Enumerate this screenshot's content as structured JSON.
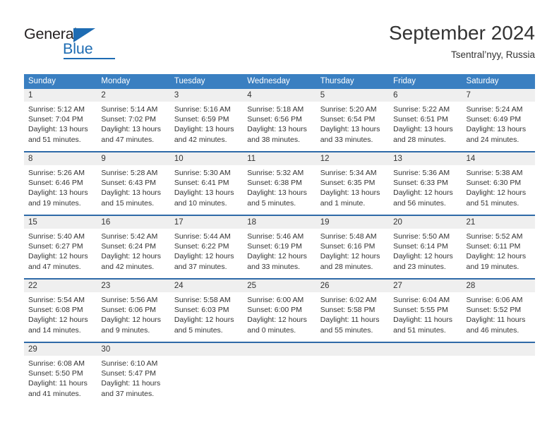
{
  "brand": {
    "name_top": "General",
    "name_bottom": "Blue",
    "accent_color": "#1e6cb3"
  },
  "header": {
    "title": "September 2024",
    "subtitle": "Tsentral’nyy, Russia"
  },
  "calendar": {
    "header_bg": "#3a7fc1",
    "row_divider_color": "#2f6aa8",
    "daynum_bg": "#efefef",
    "weekdays": [
      "Sunday",
      "Monday",
      "Tuesday",
      "Wednesday",
      "Thursday",
      "Friday",
      "Saturday"
    ],
    "weeks": [
      [
        {
          "day": "1",
          "sunrise": "Sunrise: 5:12 AM",
          "sunset": "Sunset: 7:04 PM",
          "daylight1": "Daylight: 13 hours",
          "daylight2": "and 51 minutes."
        },
        {
          "day": "2",
          "sunrise": "Sunrise: 5:14 AM",
          "sunset": "Sunset: 7:02 PM",
          "daylight1": "Daylight: 13 hours",
          "daylight2": "and 47 minutes."
        },
        {
          "day": "3",
          "sunrise": "Sunrise: 5:16 AM",
          "sunset": "Sunset: 6:59 PM",
          "daylight1": "Daylight: 13 hours",
          "daylight2": "and 42 minutes."
        },
        {
          "day": "4",
          "sunrise": "Sunrise: 5:18 AM",
          "sunset": "Sunset: 6:56 PM",
          "daylight1": "Daylight: 13 hours",
          "daylight2": "and 38 minutes."
        },
        {
          "day": "5",
          "sunrise": "Sunrise: 5:20 AM",
          "sunset": "Sunset: 6:54 PM",
          "daylight1": "Daylight: 13 hours",
          "daylight2": "and 33 minutes."
        },
        {
          "day": "6",
          "sunrise": "Sunrise: 5:22 AM",
          "sunset": "Sunset: 6:51 PM",
          "daylight1": "Daylight: 13 hours",
          "daylight2": "and 28 minutes."
        },
        {
          "day": "7",
          "sunrise": "Sunrise: 5:24 AM",
          "sunset": "Sunset: 6:49 PM",
          "daylight1": "Daylight: 13 hours",
          "daylight2": "and 24 minutes."
        }
      ],
      [
        {
          "day": "8",
          "sunrise": "Sunrise: 5:26 AM",
          "sunset": "Sunset: 6:46 PM",
          "daylight1": "Daylight: 13 hours",
          "daylight2": "and 19 minutes."
        },
        {
          "day": "9",
          "sunrise": "Sunrise: 5:28 AM",
          "sunset": "Sunset: 6:43 PM",
          "daylight1": "Daylight: 13 hours",
          "daylight2": "and 15 minutes."
        },
        {
          "day": "10",
          "sunrise": "Sunrise: 5:30 AM",
          "sunset": "Sunset: 6:41 PM",
          "daylight1": "Daylight: 13 hours",
          "daylight2": "and 10 minutes."
        },
        {
          "day": "11",
          "sunrise": "Sunrise: 5:32 AM",
          "sunset": "Sunset: 6:38 PM",
          "daylight1": "Daylight: 13 hours",
          "daylight2": "and 5 minutes."
        },
        {
          "day": "12",
          "sunrise": "Sunrise: 5:34 AM",
          "sunset": "Sunset: 6:35 PM",
          "daylight1": "Daylight: 13 hours",
          "daylight2": "and 1 minute."
        },
        {
          "day": "13",
          "sunrise": "Sunrise: 5:36 AM",
          "sunset": "Sunset: 6:33 PM",
          "daylight1": "Daylight: 12 hours",
          "daylight2": "and 56 minutes."
        },
        {
          "day": "14",
          "sunrise": "Sunrise: 5:38 AM",
          "sunset": "Sunset: 6:30 PM",
          "daylight1": "Daylight: 12 hours",
          "daylight2": "and 51 minutes."
        }
      ],
      [
        {
          "day": "15",
          "sunrise": "Sunrise: 5:40 AM",
          "sunset": "Sunset: 6:27 PM",
          "daylight1": "Daylight: 12 hours",
          "daylight2": "and 47 minutes."
        },
        {
          "day": "16",
          "sunrise": "Sunrise: 5:42 AM",
          "sunset": "Sunset: 6:24 PM",
          "daylight1": "Daylight: 12 hours",
          "daylight2": "and 42 minutes."
        },
        {
          "day": "17",
          "sunrise": "Sunrise: 5:44 AM",
          "sunset": "Sunset: 6:22 PM",
          "daylight1": "Daylight: 12 hours",
          "daylight2": "and 37 minutes."
        },
        {
          "day": "18",
          "sunrise": "Sunrise: 5:46 AM",
          "sunset": "Sunset: 6:19 PM",
          "daylight1": "Daylight: 12 hours",
          "daylight2": "and 33 minutes."
        },
        {
          "day": "19",
          "sunrise": "Sunrise: 5:48 AM",
          "sunset": "Sunset: 6:16 PM",
          "daylight1": "Daylight: 12 hours",
          "daylight2": "and 28 minutes."
        },
        {
          "day": "20",
          "sunrise": "Sunrise: 5:50 AM",
          "sunset": "Sunset: 6:14 PM",
          "daylight1": "Daylight: 12 hours",
          "daylight2": "and 23 minutes."
        },
        {
          "day": "21",
          "sunrise": "Sunrise: 5:52 AM",
          "sunset": "Sunset: 6:11 PM",
          "daylight1": "Daylight: 12 hours",
          "daylight2": "and 19 minutes."
        }
      ],
      [
        {
          "day": "22",
          "sunrise": "Sunrise: 5:54 AM",
          "sunset": "Sunset: 6:08 PM",
          "daylight1": "Daylight: 12 hours",
          "daylight2": "and 14 minutes."
        },
        {
          "day": "23",
          "sunrise": "Sunrise: 5:56 AM",
          "sunset": "Sunset: 6:06 PM",
          "daylight1": "Daylight: 12 hours",
          "daylight2": "and 9 minutes."
        },
        {
          "day": "24",
          "sunrise": "Sunrise: 5:58 AM",
          "sunset": "Sunset: 6:03 PM",
          "daylight1": "Daylight: 12 hours",
          "daylight2": "and 5 minutes."
        },
        {
          "day": "25",
          "sunrise": "Sunrise: 6:00 AM",
          "sunset": "Sunset: 6:00 PM",
          "daylight1": "Daylight: 12 hours",
          "daylight2": "and 0 minutes."
        },
        {
          "day": "26",
          "sunrise": "Sunrise: 6:02 AM",
          "sunset": "Sunset: 5:58 PM",
          "daylight1": "Daylight: 11 hours",
          "daylight2": "and 55 minutes."
        },
        {
          "day": "27",
          "sunrise": "Sunrise: 6:04 AM",
          "sunset": "Sunset: 5:55 PM",
          "daylight1": "Daylight: 11 hours",
          "daylight2": "and 51 minutes."
        },
        {
          "day": "28",
          "sunrise": "Sunrise: 6:06 AM",
          "sunset": "Sunset: 5:52 PM",
          "daylight1": "Daylight: 11 hours",
          "daylight2": "and 46 minutes."
        }
      ],
      [
        {
          "day": "29",
          "sunrise": "Sunrise: 6:08 AM",
          "sunset": "Sunset: 5:50 PM",
          "daylight1": "Daylight: 11 hours",
          "daylight2": "and 41 minutes."
        },
        {
          "day": "30",
          "sunrise": "Sunrise: 6:10 AM",
          "sunset": "Sunset: 5:47 PM",
          "daylight1": "Daylight: 11 hours",
          "daylight2": "and 37 minutes."
        },
        {
          "day": "",
          "sunrise": "",
          "sunset": "",
          "daylight1": "",
          "daylight2": ""
        },
        {
          "day": "",
          "sunrise": "",
          "sunset": "",
          "daylight1": "",
          "daylight2": ""
        },
        {
          "day": "",
          "sunrise": "",
          "sunset": "",
          "daylight1": "",
          "daylight2": ""
        },
        {
          "day": "",
          "sunrise": "",
          "sunset": "",
          "daylight1": "",
          "daylight2": ""
        },
        {
          "day": "",
          "sunrise": "",
          "sunset": "",
          "daylight1": "",
          "daylight2": ""
        }
      ]
    ]
  }
}
